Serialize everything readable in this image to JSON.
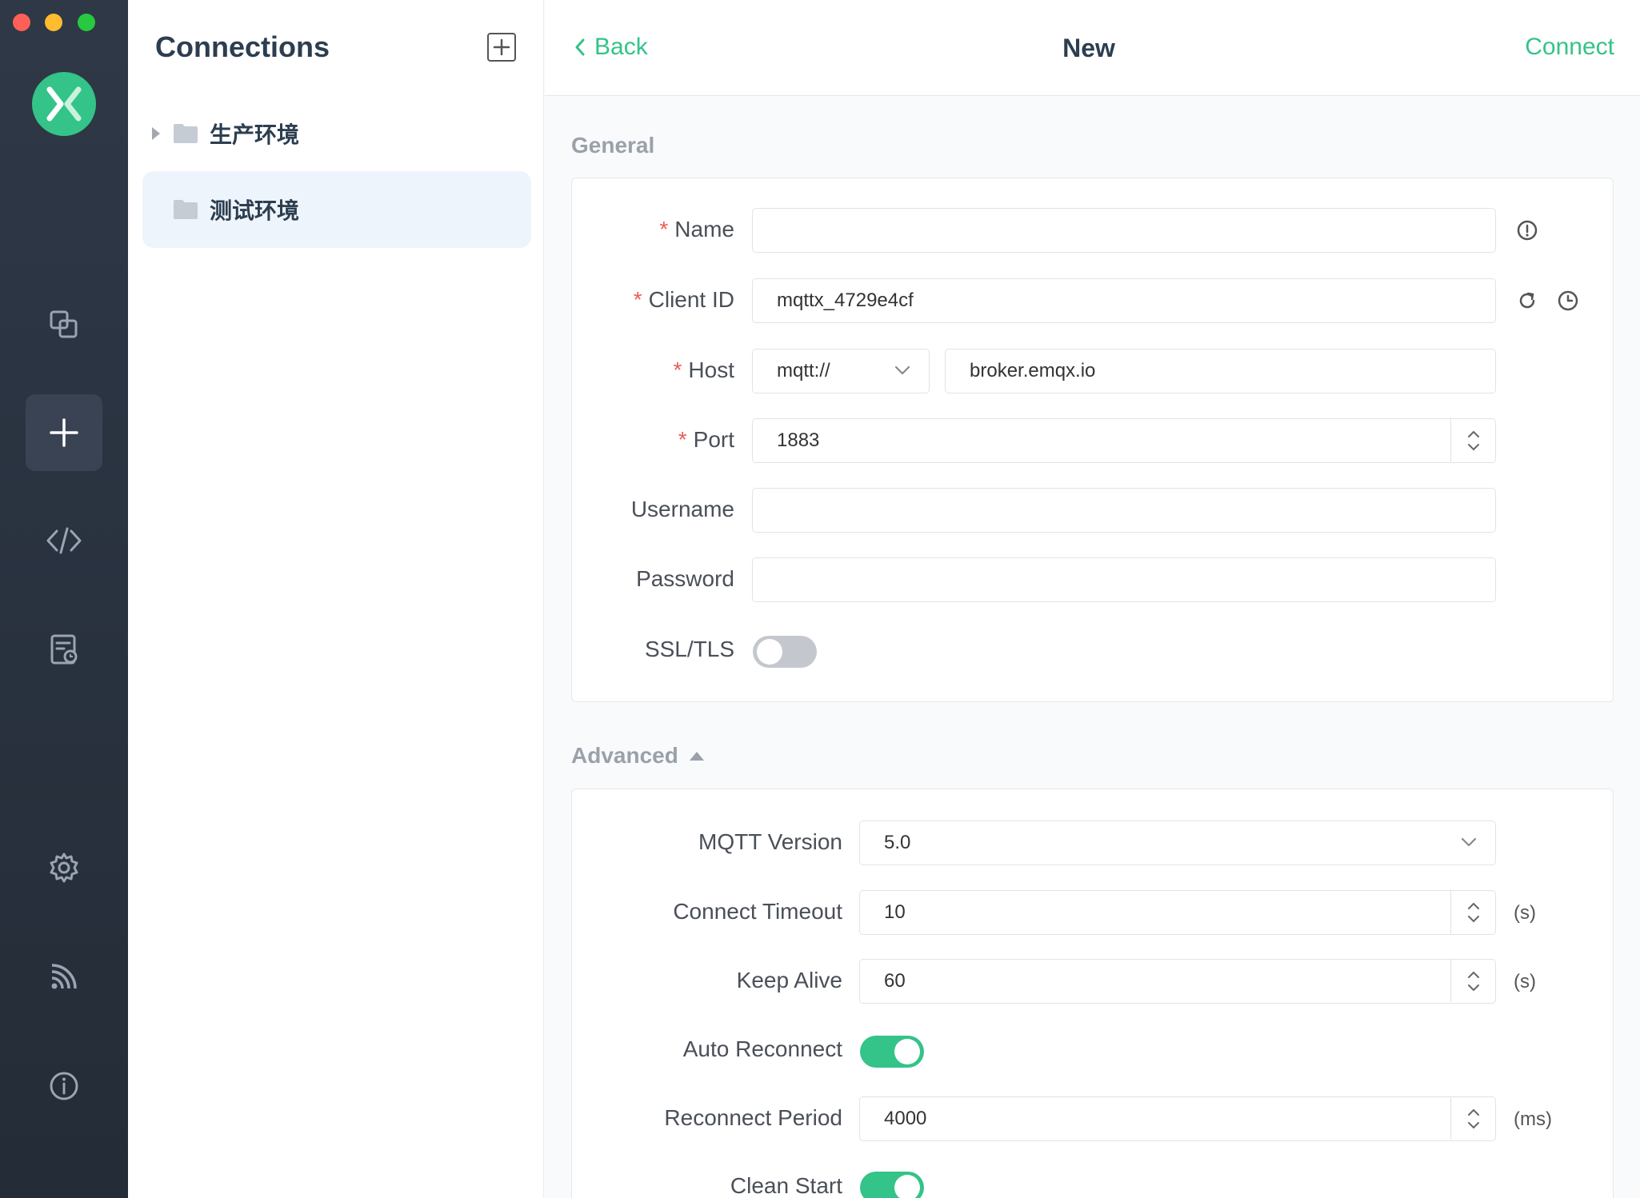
{
  "window": {
    "controls": [
      "close",
      "minimize",
      "zoom"
    ]
  },
  "sidebar": {
    "icons": [
      "connections-icon",
      "new-connection-icon",
      "script-icon",
      "log-icon",
      "settings-icon",
      "feed-icon",
      "about-icon"
    ],
    "active": "new-connection-icon"
  },
  "connections": {
    "title": "Connections",
    "groups": [
      {
        "label": "生产环境",
        "collapsed": true
      },
      {
        "label": "测试环境",
        "selected": true
      }
    ]
  },
  "header": {
    "back_label": "Back",
    "title": "New",
    "connect_label": "Connect"
  },
  "general": {
    "title": "General",
    "required_mark": "*",
    "name": {
      "label": "Name",
      "value": ""
    },
    "client_id": {
      "label": "Client ID",
      "value": "mqttx_4729e4cf"
    },
    "host": {
      "label": "Host",
      "protocol": "mqtt://",
      "value": "broker.emqx.io"
    },
    "port": {
      "label": "Port",
      "value": "1883"
    },
    "username": {
      "label": "Username",
      "value": ""
    },
    "password": {
      "label": "Password",
      "value": ""
    },
    "ssl": {
      "label": "SSL/TLS",
      "enabled": false
    }
  },
  "advanced": {
    "title": "Advanced",
    "mqtt_version": {
      "label": "MQTT Version",
      "value": "5.0"
    },
    "connect_timeout": {
      "label": "Connect Timeout",
      "value": "10",
      "unit": "(s)"
    },
    "keep_alive": {
      "label": "Keep Alive",
      "value": "60",
      "unit": "(s)"
    },
    "auto_reconnect": {
      "label": "Auto Reconnect",
      "enabled": true
    },
    "reconnect_period": {
      "label": "Reconnect Period",
      "value": "4000",
      "unit": "(ms)"
    },
    "clean_start": {
      "label": "Clean Start",
      "enabled": true
    }
  },
  "colors": {
    "accent": "#34c388",
    "sidebar": "#2a3340",
    "required": "#ec5b56"
  }
}
